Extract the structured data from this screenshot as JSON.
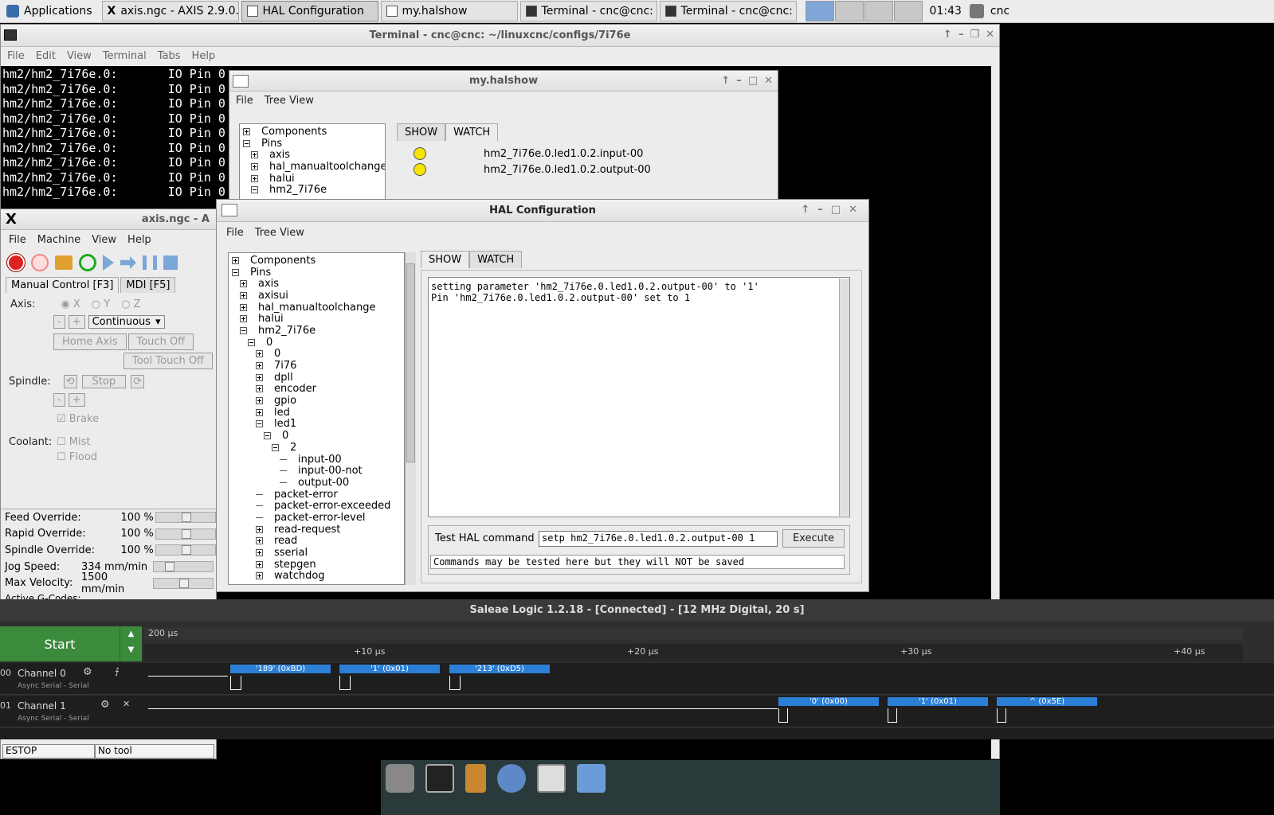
{
  "taskbar": {
    "applications": "Applications",
    "tasks": [
      "axis.ngc - AXIS 2.9.0...",
      "HAL Configuration",
      "my.halshow",
      "Terminal - cnc@cnc: ~",
      "Terminal - cnc@cnc: ..."
    ],
    "clock": "01:43",
    "user": "cnc"
  },
  "terminal": {
    "title": "Terminal - cnc@cnc: ~/linuxcnc/configs/7i76e",
    "menu": [
      "File",
      "Edit",
      "View",
      "Terminal",
      "Tabs",
      "Help"
    ],
    "lines": [
      "hm2/hm2_7i76e.0:       IO Pin 0",
      "hm2/hm2_7i76e.0:       IO Pin 0",
      "hm2/hm2_7i76e.0:       IO Pin 0",
      "hm2/hm2_7i76e.0:       IO Pin 0",
      "hm2/hm2_7i76e.0:       IO Pin 0",
      "hm2/hm2_7i76e.0:       IO Pin 0",
      "hm2/hm2_7i76e.0:       IO Pin 0",
      "hm2/hm2_7i76e.0:       IO Pin 0",
      "hm2/hm2_7i76e.0:       IO Pin 0"
    ]
  },
  "halshow": {
    "title": "my.halshow",
    "menu": [
      "File",
      "Tree View"
    ],
    "tree": [
      "Components",
      "Pins",
      "axis",
      "hal_manualtoolchange",
      "halui",
      "hm2_7i76e"
    ],
    "tabs": [
      "SHOW",
      "WATCH"
    ],
    "watch": [
      "hm2_7i76e.0.led1.0.2.input-00",
      "hm2_7i76e.0.led1.0.2.output-00"
    ]
  },
  "axis": {
    "title": "axis.ngc - A",
    "menu": [
      "File",
      "Machine",
      "View",
      "Help"
    ],
    "tabs": [
      "Manual Control [F3]",
      "MDI [F5]"
    ],
    "axis_label": "Axis:",
    "axes": [
      "X",
      "Y",
      "Z"
    ],
    "jog_mode": "Continuous",
    "home_axis": "Home Axis",
    "touch_off": "Touch Off",
    "tool_touch_off": "Tool Touch Off",
    "spindle_label": "Spindle:",
    "stop": "Stop",
    "brake": "Brake",
    "coolant_label": "Coolant:",
    "mist": "Mist",
    "flood": "Flood",
    "overrides": [
      {
        "label": "Feed Override:",
        "value": "100 %"
      },
      {
        "label": "Rapid Override:",
        "value": "100 %"
      },
      {
        "label": "Spindle Override:",
        "value": "100 %"
      },
      {
        "label": "Jog Speed:",
        "value": "334 mm/min"
      },
      {
        "label": "Max Velocity:",
        "value": "1500 mm/min"
      }
    ],
    "active_gcodes": "Active G-Codes:",
    "status_estop": "ESTOP",
    "status_tool": "No tool"
  },
  "halconfig": {
    "title": "HAL Configuration",
    "menu": [
      "File",
      "Tree View"
    ],
    "tabs": [
      "SHOW",
      "WATCH"
    ],
    "tree": [
      {
        "text": "Components",
        "level": 0,
        "node": "plus"
      },
      {
        "text": "Pins",
        "level": 0,
        "node": "minus"
      },
      {
        "text": "axis",
        "level": 1,
        "node": "plus"
      },
      {
        "text": "axisui",
        "level": 1,
        "node": "plus"
      },
      {
        "text": "hal_manualtoolchange",
        "level": 1,
        "node": "plus"
      },
      {
        "text": "halui",
        "level": 1,
        "node": "plus"
      },
      {
        "text": "hm2_7i76e",
        "level": 1,
        "node": "minus"
      },
      {
        "text": "0",
        "level": 2,
        "node": "minus"
      },
      {
        "text": "0",
        "level": 3,
        "node": "plus"
      },
      {
        "text": "7i76",
        "level": 3,
        "node": "plus"
      },
      {
        "text": "dpll",
        "level": 3,
        "node": "plus"
      },
      {
        "text": "encoder",
        "level": 3,
        "node": "plus"
      },
      {
        "text": "gpio",
        "level": 3,
        "node": "plus"
      },
      {
        "text": "led",
        "level": 3,
        "node": "plus"
      },
      {
        "text": "led1",
        "level": 3,
        "node": "minus"
      },
      {
        "text": "0",
        "level": 4,
        "node": "minus"
      },
      {
        "text": "2",
        "level": 5,
        "node": "minus"
      },
      {
        "text": "input-00",
        "level": 6,
        "node": "leaf"
      },
      {
        "text": "input-00-not",
        "level": 6,
        "node": "leaf"
      },
      {
        "text": "output-00",
        "level": 6,
        "node": "leaf"
      },
      {
        "text": "packet-error",
        "level": 3,
        "node": "leaf"
      },
      {
        "text": "packet-error-exceeded",
        "level": 3,
        "node": "leaf"
      },
      {
        "text": "packet-error-level",
        "level": 3,
        "node": "leaf"
      },
      {
        "text": "read-request",
        "level": 3,
        "node": "plus"
      },
      {
        "text": "read",
        "level": 3,
        "node": "plus"
      },
      {
        "text": "sserial",
        "level": 3,
        "node": "plus"
      },
      {
        "text": "stepgen",
        "level": 3,
        "node": "plus"
      },
      {
        "text": "watchdog",
        "level": 3,
        "node": "plus"
      }
    ],
    "output_lines": [
      "setting parameter 'hm2_7i76e.0.led1.0.2.output-00' to '1'",
      "Pin 'hm2_7i76e.0.led1.0.2.output-00' set to 1"
    ],
    "test_label": "Test HAL command :",
    "command": "setp hm2_7i76e.0.led1.0.2.output-00 1",
    "execute": "Execute",
    "note": "Commands may be tested here but they will NOT be saved"
  },
  "saleae": {
    "title": "Saleae Logic 1.2.18 - [Connected] - [12 MHz Digital, 20 s]",
    "start": "Start",
    "scale": "200 µs",
    "ticks": [
      "+10 µs",
      "+20 µs",
      "+30 µs",
      "+40 µs"
    ],
    "channels": [
      {
        "num": "00",
        "name": "Channel 0",
        "analyzer": "Async Serial - Serial",
        "decoded": [
          "'189' (0xBD)",
          "'1' (0x01)",
          "'213' (0xD5)"
        ]
      },
      {
        "num": "01",
        "name": "Channel 1",
        "analyzer": "Async Serial - Serial",
        "decoded": [
          "'0' (0x00)",
          "'1' (0x01)",
          "^ (0x5E)"
        ]
      }
    ]
  },
  "colors": {
    "accent": "#2c7fd6",
    "start_green": "#3c8a3c",
    "led_yellow": "#f5e400"
  }
}
